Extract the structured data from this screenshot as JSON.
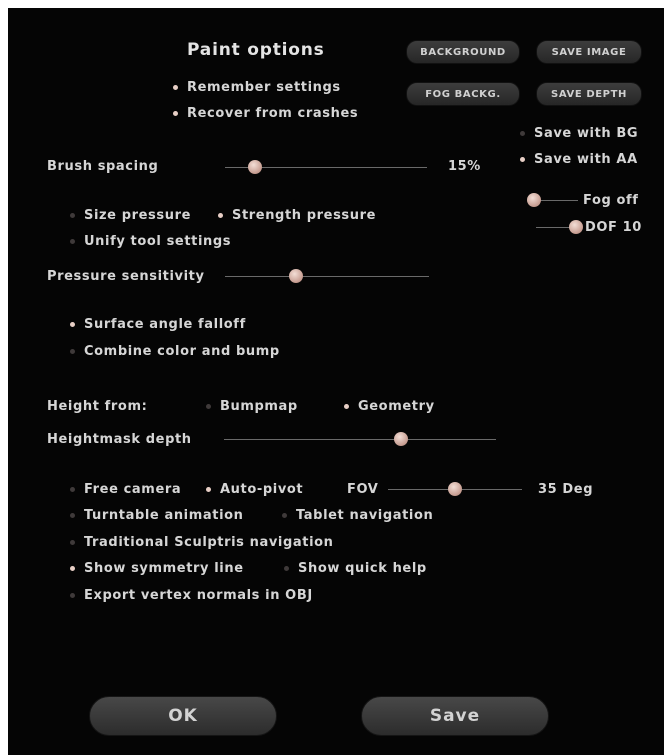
{
  "title": "Paint options",
  "buttons": {
    "background": "BACKGROUND",
    "save_image": "SAVE IMAGE",
    "fog_backg": "FOG BACKG.",
    "save_depth": "SAVE DEPTH",
    "ok": "OK",
    "save": "Save"
  },
  "options": {
    "remember_settings": "Remember settings",
    "recover_from_crashes": "Recover from crashes",
    "save_with_bg": "Save with BG",
    "save_with_aa": "Save with AA",
    "size_pressure": "Size pressure",
    "strength_pressure": "Strength pressure",
    "unify_tool_settings": "Unify tool settings",
    "surface_angle_falloff": "Surface angle falloff",
    "combine_color_and_bump": "Combine color and bump",
    "bumpmap": "Bumpmap",
    "geometry": "Geometry",
    "free_camera": "Free camera",
    "auto_pivot": "Auto-pivot",
    "turntable_animation": "Turntable animation",
    "tablet_navigation": "Tablet navigation",
    "traditional_navigation": "Traditional Sculptris navigation",
    "show_symmetry_line": "Show symmetry line",
    "show_quick_help": "Show quick help",
    "export_vertex_normals": "Export vertex normals in OBJ"
  },
  "labels": {
    "brush_spacing": "Brush spacing",
    "brush_spacing_value": "15%",
    "fog": "Fog off",
    "dof": "DOF 10",
    "pressure_sensitivity": "Pressure sensitivity",
    "height_from": "Height from:",
    "heightmask_depth": "Heightmask depth",
    "fov": "FOV",
    "fov_value": "35 Deg"
  },
  "sliders": {
    "brush_spacing": 0.15,
    "fog": 0.0,
    "dof": 0.9,
    "pressure_sensitivity": 0.35,
    "heightmask_depth": 0.65,
    "fov": 0.5
  },
  "colors": {
    "background": "#050505",
    "dot_on": "#e8cfc6",
    "dot_off": "#3f3a3a",
    "text": "#d6d6d6"
  }
}
